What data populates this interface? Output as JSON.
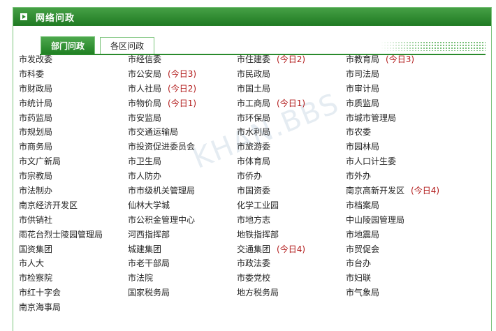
{
  "header": {
    "title": "网络问政"
  },
  "tabs": [
    {
      "label": "部门问政",
      "active": true
    },
    {
      "label": "各区问政",
      "active": false
    }
  ],
  "watermark": "KHAN.BBS",
  "colors": {
    "brand_green": "#1f7a22",
    "highlight_red": "#b21b1b"
  },
  "rows": [
    [
      {
        "name": "市发改委",
        "tag": ""
      },
      {
        "name": "市经信委",
        "tag": ""
      },
      {
        "name": "市住建委",
        "tag": "(今日2)"
      },
      {
        "name": "市教育局",
        "tag": "(今日3)"
      }
    ],
    [
      {
        "name": "市科委",
        "tag": ""
      },
      {
        "name": "市公安局",
        "tag": "(今日3)"
      },
      {
        "name": "市民政局",
        "tag": ""
      },
      {
        "name": "市司法局",
        "tag": ""
      }
    ],
    [
      {
        "name": "市财政局",
        "tag": ""
      },
      {
        "name": "市人社局",
        "tag": "(今日2)"
      },
      {
        "name": "市国土局",
        "tag": ""
      },
      {
        "name": "市审计局",
        "tag": ""
      }
    ],
    [
      {
        "name": "市统计局",
        "tag": ""
      },
      {
        "name": "市物价局",
        "tag": "(今日1)"
      },
      {
        "name": "市工商局",
        "tag": "(今日1)"
      },
      {
        "name": "市质监局",
        "tag": ""
      }
    ],
    [
      {
        "name": "市药监局",
        "tag": ""
      },
      {
        "name": "市安监局",
        "tag": ""
      },
      {
        "name": "市环保局",
        "tag": ""
      },
      {
        "name": "市城市管理局",
        "tag": ""
      }
    ],
    [
      {
        "name": "市规划局",
        "tag": ""
      },
      {
        "name": "市交通运输局",
        "tag": ""
      },
      {
        "name": "市水利局",
        "tag": ""
      },
      {
        "name": "市农委",
        "tag": ""
      }
    ],
    [
      {
        "name": "市商务局",
        "tag": ""
      },
      {
        "name": "市投资促进委员会",
        "tag": ""
      },
      {
        "name": "市旅游委",
        "tag": ""
      },
      {
        "name": "市园林局",
        "tag": ""
      }
    ],
    [
      {
        "name": "市文广新局",
        "tag": ""
      },
      {
        "name": "市卫生局",
        "tag": ""
      },
      {
        "name": "市体育局",
        "tag": ""
      },
      {
        "name": "市人口计生委",
        "tag": ""
      }
    ],
    [
      {
        "name": "市宗教局",
        "tag": ""
      },
      {
        "name": "市人防办",
        "tag": ""
      },
      {
        "name": "市侨办",
        "tag": ""
      },
      {
        "name": "市外办",
        "tag": ""
      }
    ],
    [
      {
        "name": "市法制办",
        "tag": ""
      },
      {
        "name": "市市级机关管理局",
        "tag": ""
      },
      {
        "name": "市国资委",
        "tag": ""
      },
      {
        "name": "南京高新开发区",
        "tag": "(今日4)"
      }
    ],
    [
      {
        "name": "南京经济开发区",
        "tag": ""
      },
      {
        "name": "仙林大学城",
        "tag": ""
      },
      {
        "name": "化学工业园",
        "tag": ""
      },
      {
        "name": "市档案局",
        "tag": ""
      }
    ],
    [
      {
        "name": "市供销社",
        "tag": ""
      },
      {
        "name": "市公积金管理中心",
        "tag": ""
      },
      {
        "name": "市地方志",
        "tag": ""
      },
      {
        "name": "中山陵园管理局",
        "tag": ""
      }
    ],
    [
      {
        "name": "雨花台烈士陵园管理局",
        "tag": ""
      },
      {
        "name": "河西指挥部",
        "tag": ""
      },
      {
        "name": "地铁指挥部",
        "tag": ""
      },
      {
        "name": "市地震局",
        "tag": ""
      }
    ],
    [
      {
        "name": "国资集团",
        "tag": ""
      },
      {
        "name": "城建集团",
        "tag": ""
      },
      {
        "name": "交通集团",
        "tag": "(今日4)"
      },
      {
        "name": "市贸促会",
        "tag": ""
      }
    ],
    [
      {
        "name": "市人大",
        "tag": ""
      },
      {
        "name": "市老干部局",
        "tag": ""
      },
      {
        "name": "市政法委",
        "tag": ""
      },
      {
        "name": "市台办",
        "tag": ""
      }
    ],
    [
      {
        "name": "市检察院",
        "tag": ""
      },
      {
        "name": "市法院",
        "tag": ""
      },
      {
        "name": "市委党校",
        "tag": ""
      },
      {
        "name": "市妇联",
        "tag": ""
      }
    ],
    [
      {
        "name": "市红十字会",
        "tag": ""
      },
      {
        "name": "国家税务局",
        "tag": ""
      },
      {
        "name": "地方税务局",
        "tag": ""
      },
      {
        "name": "市气象局",
        "tag": ""
      }
    ],
    [
      {
        "name": "南京海事局",
        "tag": ""
      }
    ]
  ]
}
